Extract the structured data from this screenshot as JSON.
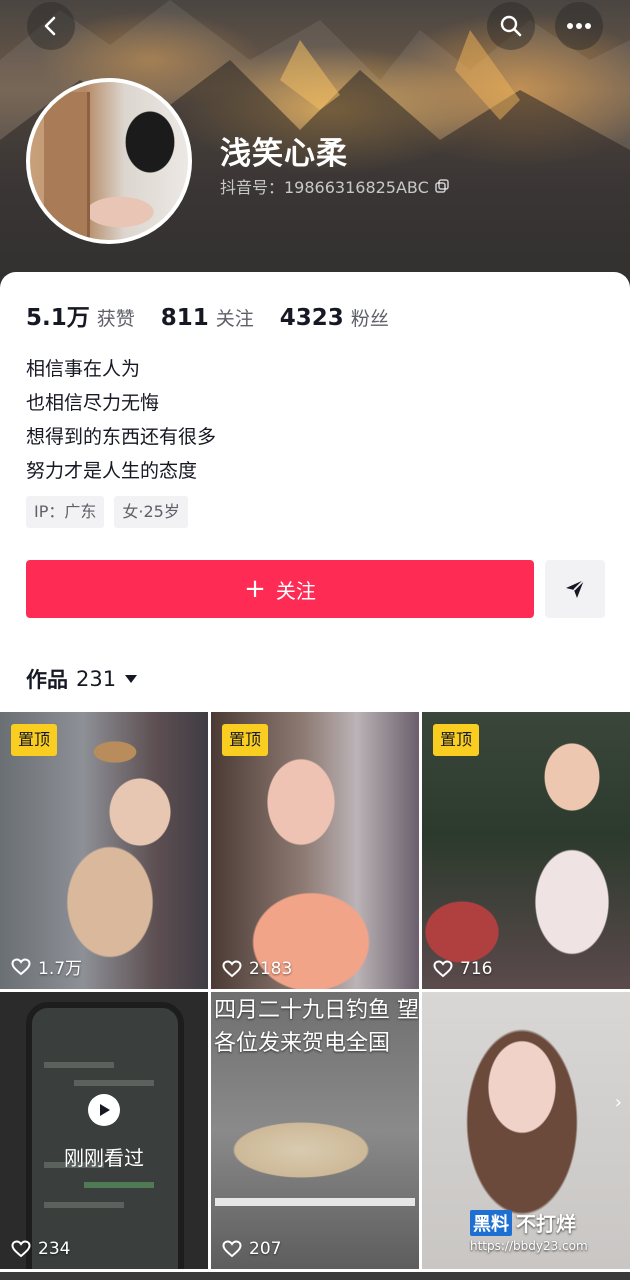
{
  "profile": {
    "nickname": "浅笑心柔",
    "douyin_id": "抖音号：19866316825ABC"
  },
  "stats": [
    {
      "value": "5.1万",
      "label": "获赞"
    },
    {
      "value": "811",
      "label": "关注"
    },
    {
      "value": "4323",
      "label": "粉丝"
    }
  ],
  "bio": [
    "相信事在人为",
    "也相信尽力无悔",
    "想得到的东西还有很多",
    "努力才是人生的态度"
  ],
  "tags": [
    "IP：广东",
    "女·25岁"
  ],
  "actions": {
    "follow_label": "关注"
  },
  "works": {
    "title": "作品",
    "count": "231"
  },
  "videos": [
    {
      "pinned_label": "置顶",
      "likes": "1.7万"
    },
    {
      "pinned_label": "置顶",
      "likes": "2183"
    },
    {
      "pinned_label": "置顶",
      "likes": "716"
    },
    {
      "overlay": "刚刚看过",
      "likes": "234"
    },
    {
      "caption": "四月二十九日钓鱼 望各位发来贺电全国",
      "likes": "207"
    },
    {
      "likes": ""
    }
  ],
  "watermark": {
    "brand_box": "黑料",
    "brand_text": "不打烊",
    "url": "https://bbdy23.com"
  },
  "colors": {
    "accent": "#fe2c55",
    "pin": "#facd21",
    "text": "#161823",
    "muted": "#5f6068"
  },
  "icons": [
    "back-icon",
    "search-icon",
    "more-icon",
    "copy-icon",
    "share-icon",
    "dropdown-icon",
    "heart-icon",
    "play-icon"
  ]
}
